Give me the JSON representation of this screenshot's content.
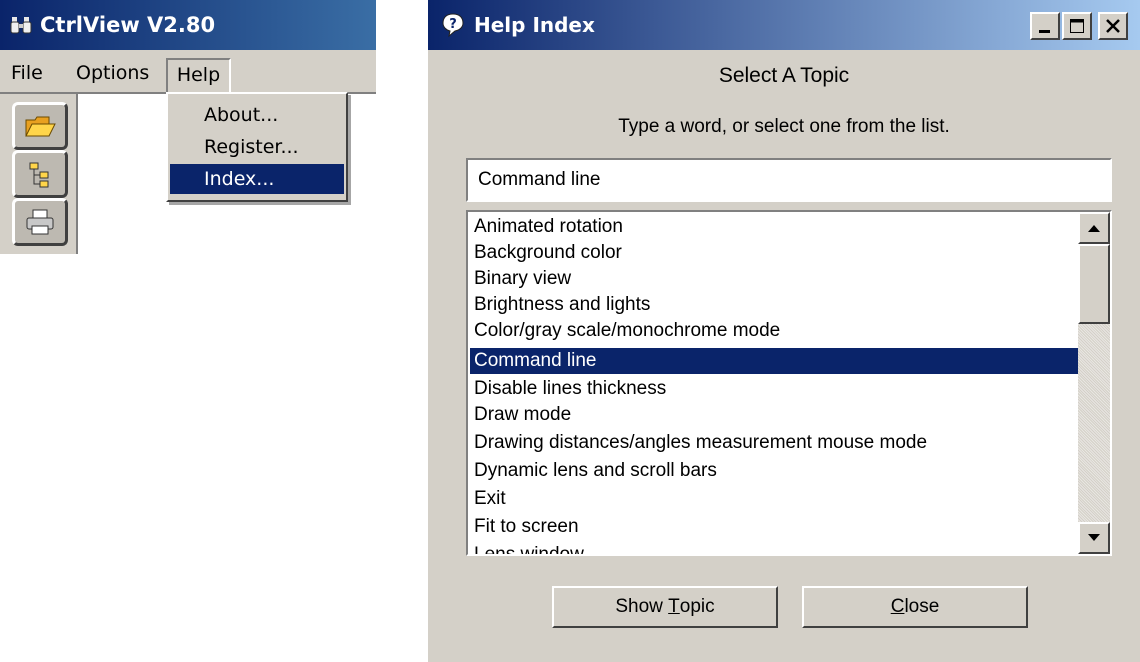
{
  "app": {
    "title": "CtrlView V2.80",
    "menu": [
      "File",
      "Options",
      "Help"
    ],
    "help_menu": [
      "About...",
      "Register...",
      "Index..."
    ],
    "selected_menu_item": "Index...",
    "toolbar_icons": [
      "open-folder-icon",
      "tree-view-icon",
      "print-icon"
    ]
  },
  "help_dialog": {
    "title": "Help Index",
    "caption_buttons": [
      "minimize",
      "maximize",
      "close"
    ],
    "heading": "Select A Topic",
    "instructions": "Type a word, or select one from the list.",
    "search_value": "Command line",
    "topics": [
      "Animated rotation",
      "Background color",
      "Binary view",
      "Brightness and lights",
      "Color/gray scale/monochrome mode",
      "Command line",
      "Disable lines thickness",
      "Draw mode",
      "Drawing distances/angles measurement mouse mode",
      "Dynamic lens and scroll bars",
      "Exit",
      "Fit to screen",
      "Lens window"
    ],
    "selected_topic": "Command line",
    "buttons": {
      "show_topic_pre": "Show ",
      "show_topic_accel": "T",
      "show_topic_post": "opic",
      "close_accel": "C",
      "close_post": "lose"
    }
  },
  "colors": {
    "selection": "#0a246a",
    "face": "#d4d0c8",
    "title_start": "#0a246a"
  }
}
